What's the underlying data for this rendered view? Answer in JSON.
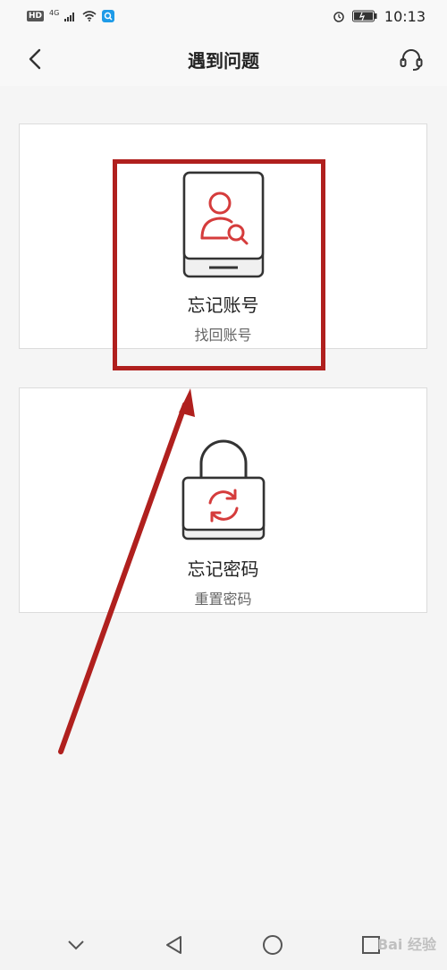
{
  "status_bar": {
    "hd": "HD",
    "network": "4G",
    "time": "10:13"
  },
  "header": {
    "title": "遇到问题",
    "back_icon": "chevron-left-icon",
    "support_icon": "headset-icon"
  },
  "cards": [
    {
      "title": "忘记账号",
      "subtitle": "找回账号",
      "icon": "user-search-tablet-icon"
    },
    {
      "title": "忘记密码",
      "subtitle": "重置密码",
      "icon": "padlock-refresh-icon"
    }
  ],
  "nav": {
    "items": [
      "chevron-down-icon",
      "back-triangle-icon",
      "home-circle-icon",
      "recent-square-icon"
    ]
  },
  "watermark": "Bai 经验",
  "colors": {
    "accent": "#d53c3c",
    "annotation": "#b0201e"
  }
}
